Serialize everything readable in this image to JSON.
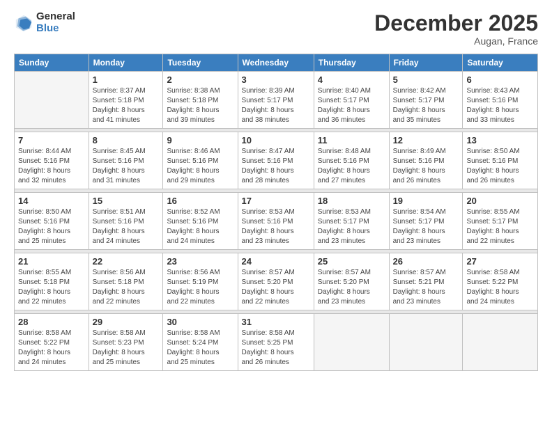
{
  "logo": {
    "general": "General",
    "blue": "Blue"
  },
  "title": "December 2025",
  "subtitle": "Augan, France",
  "days_header": [
    "Sunday",
    "Monday",
    "Tuesday",
    "Wednesday",
    "Thursday",
    "Friday",
    "Saturday"
  ],
  "weeks": [
    [
      {
        "num": "",
        "sunrise": "",
        "sunset": "",
        "daylight": ""
      },
      {
        "num": "1",
        "sunrise": "Sunrise: 8:37 AM",
        "sunset": "Sunset: 5:18 PM",
        "daylight": "Daylight: 8 hours and 41 minutes."
      },
      {
        "num": "2",
        "sunrise": "Sunrise: 8:38 AM",
        "sunset": "Sunset: 5:18 PM",
        "daylight": "Daylight: 8 hours and 39 minutes."
      },
      {
        "num": "3",
        "sunrise": "Sunrise: 8:39 AM",
        "sunset": "Sunset: 5:17 PM",
        "daylight": "Daylight: 8 hours and 38 minutes."
      },
      {
        "num": "4",
        "sunrise": "Sunrise: 8:40 AM",
        "sunset": "Sunset: 5:17 PM",
        "daylight": "Daylight: 8 hours and 36 minutes."
      },
      {
        "num": "5",
        "sunrise": "Sunrise: 8:42 AM",
        "sunset": "Sunset: 5:17 PM",
        "daylight": "Daylight: 8 hours and 35 minutes."
      },
      {
        "num": "6",
        "sunrise": "Sunrise: 8:43 AM",
        "sunset": "Sunset: 5:16 PM",
        "daylight": "Daylight: 8 hours and 33 minutes."
      }
    ],
    [
      {
        "num": "7",
        "sunrise": "Sunrise: 8:44 AM",
        "sunset": "Sunset: 5:16 PM",
        "daylight": "Daylight: 8 hours and 32 minutes."
      },
      {
        "num": "8",
        "sunrise": "Sunrise: 8:45 AM",
        "sunset": "Sunset: 5:16 PM",
        "daylight": "Daylight: 8 hours and 31 minutes."
      },
      {
        "num": "9",
        "sunrise": "Sunrise: 8:46 AM",
        "sunset": "Sunset: 5:16 PM",
        "daylight": "Daylight: 8 hours and 29 minutes."
      },
      {
        "num": "10",
        "sunrise": "Sunrise: 8:47 AM",
        "sunset": "Sunset: 5:16 PM",
        "daylight": "Daylight: 8 hours and 28 minutes."
      },
      {
        "num": "11",
        "sunrise": "Sunrise: 8:48 AM",
        "sunset": "Sunset: 5:16 PM",
        "daylight": "Daylight: 8 hours and 27 minutes."
      },
      {
        "num": "12",
        "sunrise": "Sunrise: 8:49 AM",
        "sunset": "Sunset: 5:16 PM",
        "daylight": "Daylight: 8 hours and 26 minutes."
      },
      {
        "num": "13",
        "sunrise": "Sunrise: 8:50 AM",
        "sunset": "Sunset: 5:16 PM",
        "daylight": "Daylight: 8 hours and 26 minutes."
      }
    ],
    [
      {
        "num": "14",
        "sunrise": "Sunrise: 8:50 AM",
        "sunset": "Sunset: 5:16 PM",
        "daylight": "Daylight: 8 hours and 25 minutes."
      },
      {
        "num": "15",
        "sunrise": "Sunrise: 8:51 AM",
        "sunset": "Sunset: 5:16 PM",
        "daylight": "Daylight: 8 hours and 24 minutes."
      },
      {
        "num": "16",
        "sunrise": "Sunrise: 8:52 AM",
        "sunset": "Sunset: 5:16 PM",
        "daylight": "Daylight: 8 hours and 24 minutes."
      },
      {
        "num": "17",
        "sunrise": "Sunrise: 8:53 AM",
        "sunset": "Sunset: 5:16 PM",
        "daylight": "Daylight: 8 hours and 23 minutes."
      },
      {
        "num": "18",
        "sunrise": "Sunrise: 8:53 AM",
        "sunset": "Sunset: 5:17 PM",
        "daylight": "Daylight: 8 hours and 23 minutes."
      },
      {
        "num": "19",
        "sunrise": "Sunrise: 8:54 AM",
        "sunset": "Sunset: 5:17 PM",
        "daylight": "Daylight: 8 hours and 23 minutes."
      },
      {
        "num": "20",
        "sunrise": "Sunrise: 8:55 AM",
        "sunset": "Sunset: 5:17 PM",
        "daylight": "Daylight: 8 hours and 22 minutes."
      }
    ],
    [
      {
        "num": "21",
        "sunrise": "Sunrise: 8:55 AM",
        "sunset": "Sunset: 5:18 PM",
        "daylight": "Daylight: 8 hours and 22 minutes."
      },
      {
        "num": "22",
        "sunrise": "Sunrise: 8:56 AM",
        "sunset": "Sunset: 5:18 PM",
        "daylight": "Daylight: 8 hours and 22 minutes."
      },
      {
        "num": "23",
        "sunrise": "Sunrise: 8:56 AM",
        "sunset": "Sunset: 5:19 PM",
        "daylight": "Daylight: 8 hours and 22 minutes."
      },
      {
        "num": "24",
        "sunrise": "Sunrise: 8:57 AM",
        "sunset": "Sunset: 5:20 PM",
        "daylight": "Daylight: 8 hours and 22 minutes."
      },
      {
        "num": "25",
        "sunrise": "Sunrise: 8:57 AM",
        "sunset": "Sunset: 5:20 PM",
        "daylight": "Daylight: 8 hours and 23 minutes."
      },
      {
        "num": "26",
        "sunrise": "Sunrise: 8:57 AM",
        "sunset": "Sunset: 5:21 PM",
        "daylight": "Daylight: 8 hours and 23 minutes."
      },
      {
        "num": "27",
        "sunrise": "Sunrise: 8:58 AM",
        "sunset": "Sunset: 5:22 PM",
        "daylight": "Daylight: 8 hours and 24 minutes."
      }
    ],
    [
      {
        "num": "28",
        "sunrise": "Sunrise: 8:58 AM",
        "sunset": "Sunset: 5:22 PM",
        "daylight": "Daylight: 8 hours and 24 minutes."
      },
      {
        "num": "29",
        "sunrise": "Sunrise: 8:58 AM",
        "sunset": "Sunset: 5:23 PM",
        "daylight": "Daylight: 8 hours and 25 minutes."
      },
      {
        "num": "30",
        "sunrise": "Sunrise: 8:58 AM",
        "sunset": "Sunset: 5:24 PM",
        "daylight": "Daylight: 8 hours and 25 minutes."
      },
      {
        "num": "31",
        "sunrise": "Sunrise: 8:58 AM",
        "sunset": "Sunset: 5:25 PM",
        "daylight": "Daylight: 8 hours and 26 minutes."
      },
      {
        "num": "",
        "sunrise": "",
        "sunset": "",
        "daylight": ""
      },
      {
        "num": "",
        "sunrise": "",
        "sunset": "",
        "daylight": ""
      },
      {
        "num": "",
        "sunrise": "",
        "sunset": "",
        "daylight": ""
      }
    ]
  ]
}
